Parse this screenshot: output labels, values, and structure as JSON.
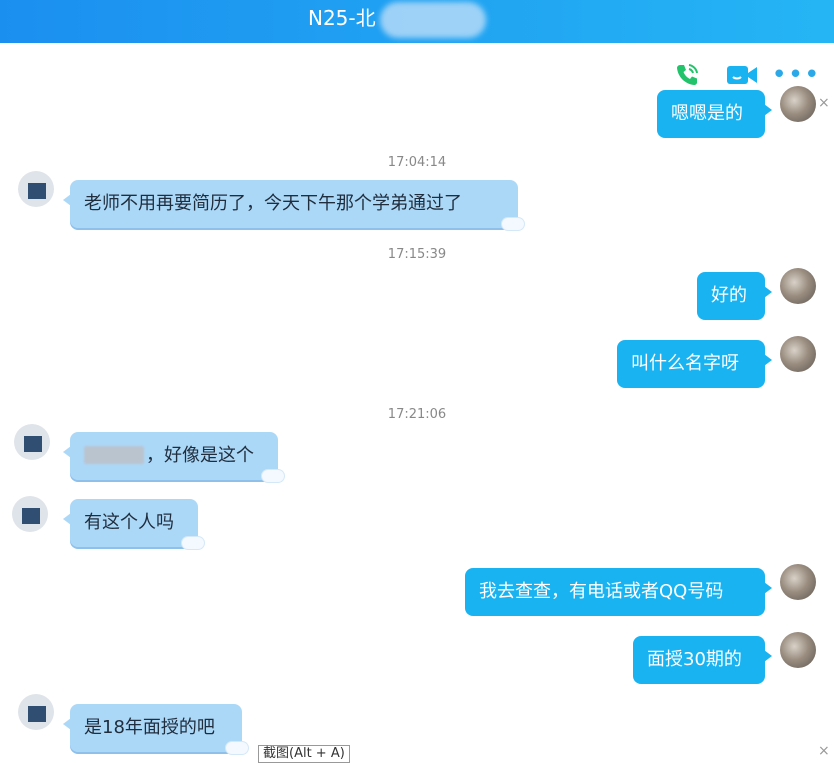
{
  "window": {
    "title": "N25-北"
  },
  "toolbar": {
    "voice_icon": "phone-call-icon",
    "video_icon": "video-call-icon",
    "more_label": "•••",
    "accent": "#19b3f2",
    "phone_color": "#22c36a"
  },
  "messages": [
    {
      "side": "right",
      "text": "嗯嗯是的"
    },
    {
      "side": "time",
      "text": "17:04:14"
    },
    {
      "side": "left",
      "text": "老师不用再要简历了，今天下午那个学弟通过了"
    },
    {
      "side": "time",
      "text": "17:15:39"
    },
    {
      "side": "right",
      "text": "好的"
    },
    {
      "side": "right",
      "text": "叫什么名字呀"
    },
    {
      "side": "time",
      "text": "17:21:06"
    },
    {
      "side": "left",
      "text": "，好像是这个"
    },
    {
      "side": "left",
      "text": "有这个人吗"
    },
    {
      "side": "right",
      "text": "我去查查，有电话或者QQ号码"
    },
    {
      "side": "right",
      "text": "面授30期的"
    },
    {
      "side": "left",
      "text": "是18年面授的吧"
    }
  ],
  "tooltip": {
    "text": "截图(Alt + A)"
  },
  "close_symbol": "×"
}
